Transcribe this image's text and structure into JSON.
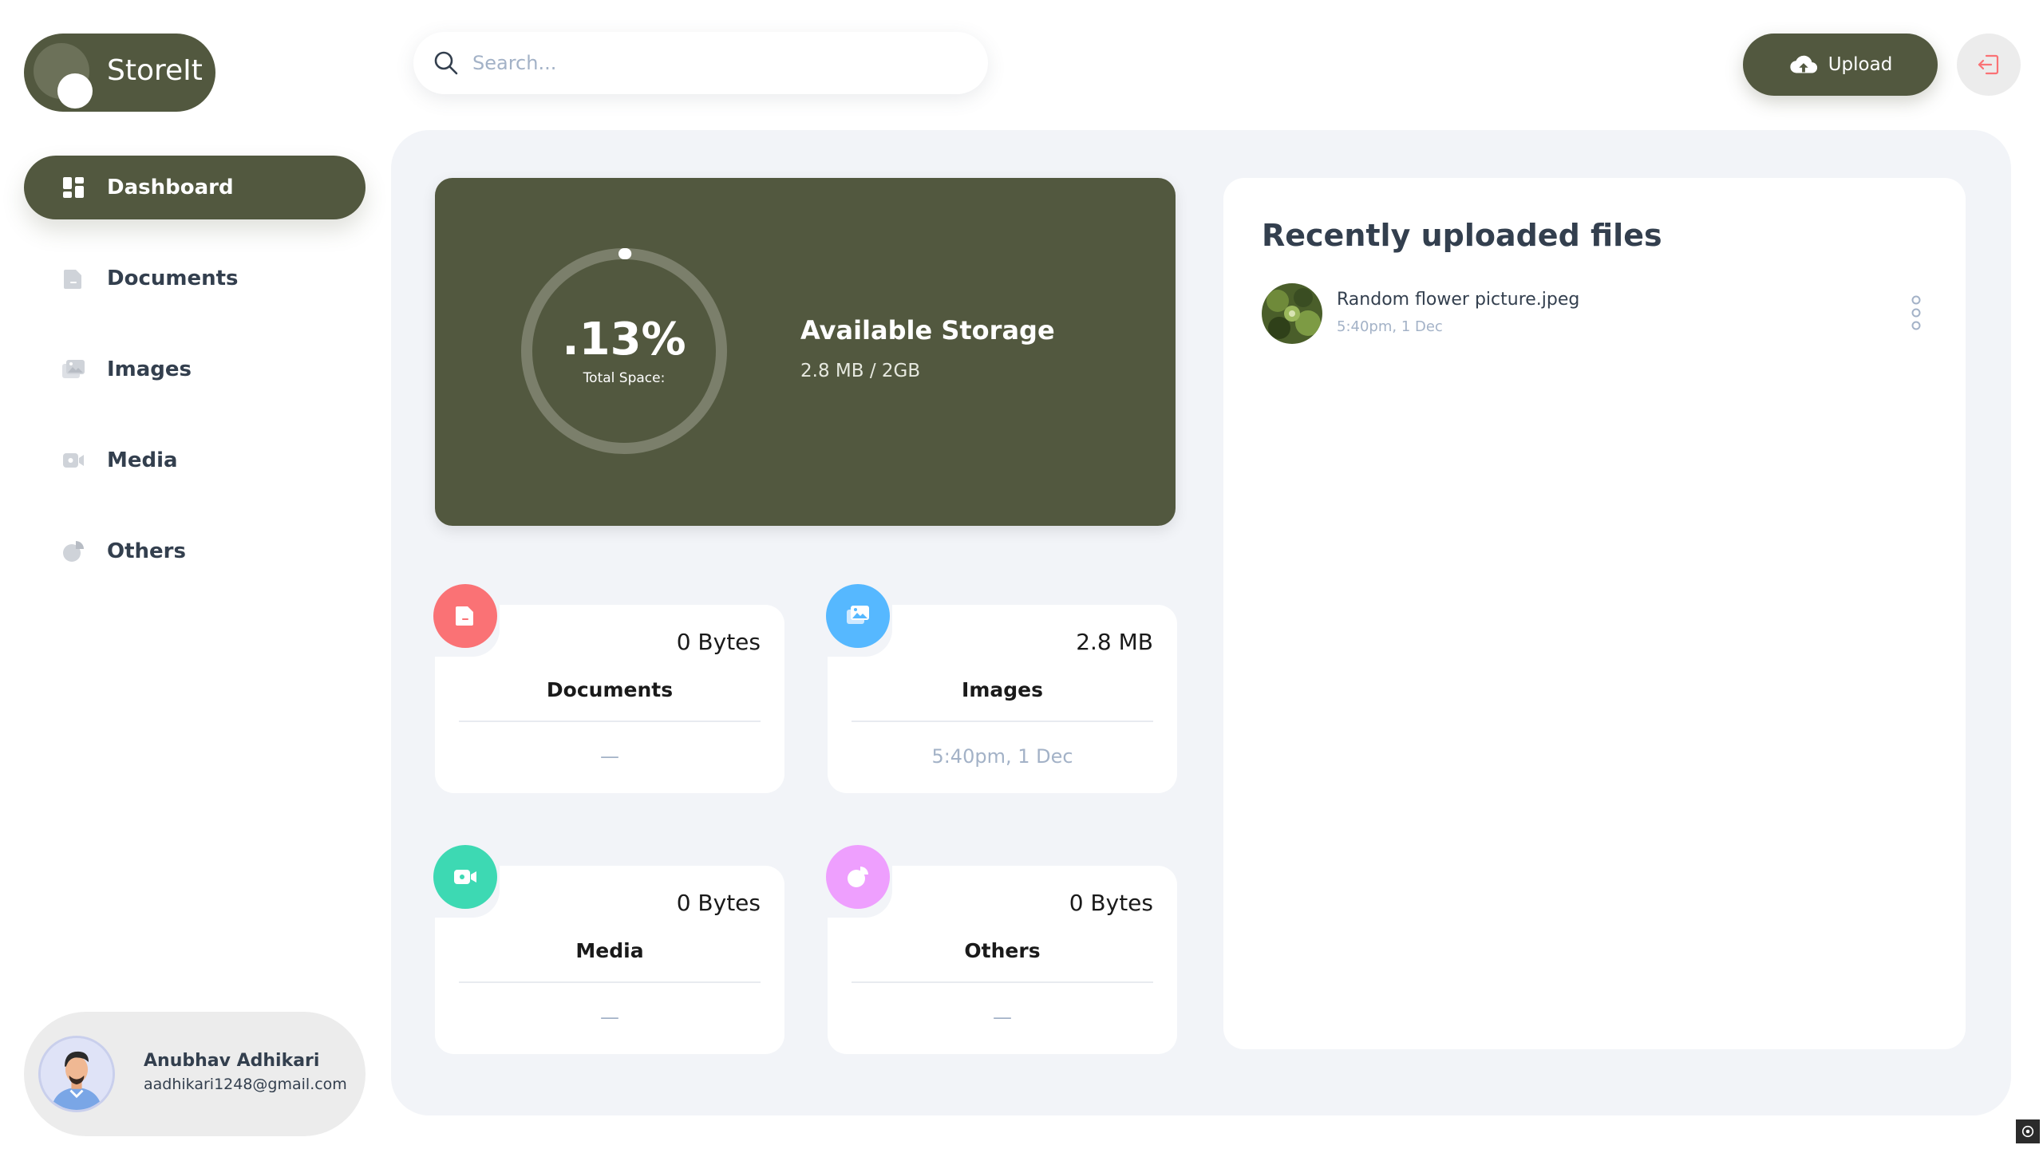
{
  "app": {
    "name": "StoreIt"
  },
  "search": {
    "placeholder": "Search..."
  },
  "header": {
    "upload_label": "Upload"
  },
  "sidebar": {
    "items": [
      {
        "label": "Dashboard",
        "icon": "dashboard-icon",
        "active": true
      },
      {
        "label": "Documents",
        "icon": "documents-icon",
        "active": false
      },
      {
        "label": "Images",
        "icon": "images-icon",
        "active": false
      },
      {
        "label": "Media",
        "icon": "media-icon",
        "active": false
      },
      {
        "label": "Others",
        "icon": "others-icon",
        "active": false
      }
    ]
  },
  "user": {
    "name": "Anubhav Adhikari",
    "email": "aadhikari1248@gmail.com"
  },
  "storage": {
    "percent_label": ".13%",
    "percent_value": 0.13,
    "subtitle": "Total Space:",
    "title": "Available Storage",
    "used": "2.8 MB / 2GB"
  },
  "summary": [
    {
      "title": "Documents",
      "size": "0 Bytes",
      "date": "—",
      "icon": "documents-icon",
      "color": "#fa7275"
    },
    {
      "title": "Images",
      "size": "2.8 MB",
      "date": "5:40pm, 1 Dec",
      "icon": "images-icon",
      "color": "#56b8ff"
    },
    {
      "title": "Media",
      "size": "0 Bytes",
      "date": "—",
      "icon": "media-icon",
      "color": "#3dd9b3"
    },
    {
      "title": "Others",
      "size": "0 Bytes",
      "date": "—",
      "icon": "others-icon",
      "color": "#ee9ffe"
    }
  ],
  "recent": {
    "title": "Recently uploaded files",
    "files": [
      {
        "name": "Random flower picture.jpeg",
        "date": "5:40pm, 1 Dec"
      }
    ]
  },
  "colors": {
    "brand": "#52583f",
    "panel": "#f2f4f8",
    "text": "#333f4e",
    "muted": "#a3b2c7"
  }
}
